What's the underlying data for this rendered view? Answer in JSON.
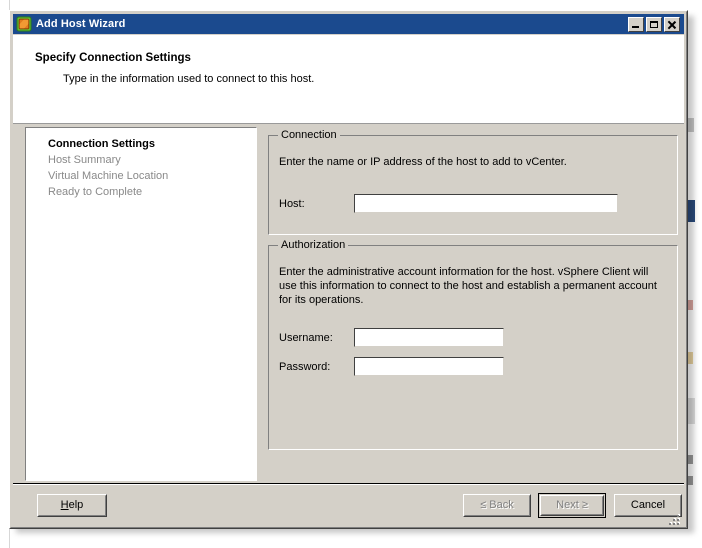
{
  "window": {
    "title": "Add Host Wizard",
    "icon": "vmware-host-icon",
    "controls": {
      "minimize": "minimize-button",
      "maximize": "maximize-button",
      "close": "close-button"
    }
  },
  "header": {
    "title": "Specify Connection Settings",
    "subtitle": "Type in the information used to connect to this host."
  },
  "sidebar": {
    "steps": [
      {
        "label": "Connection Settings",
        "state": "current"
      },
      {
        "label": "Host Summary",
        "state": "pending"
      },
      {
        "label": "Virtual Machine Location",
        "state": "pending"
      },
      {
        "label": "Ready to Complete",
        "state": "pending"
      }
    ]
  },
  "content": {
    "connection": {
      "legend": "Connection",
      "description": "Enter the name or IP address of the host to add to vCenter.",
      "host_label": "Host:",
      "host_value": "",
      "host_placeholder": ""
    },
    "authorization": {
      "legend": "Authorization",
      "description": "Enter the administrative account information for the host. vSphere Client will use this information to connect to the host and establish a permanent account for its operations.",
      "username_label": "Username:",
      "username_value": "",
      "password_label": "Password:",
      "password_value": ""
    }
  },
  "footer": {
    "help": {
      "label": "Help",
      "mnemonic": "H",
      "enabled": true
    },
    "back": {
      "label": "≤ Back",
      "enabled": false
    },
    "next": {
      "label": "Next ≥",
      "enabled": false,
      "is_default": true
    },
    "cancel": {
      "label": "Cancel",
      "enabled": true
    }
  },
  "colors": {
    "titlebar": "#1b4a8e",
    "dialog_face": "#d4d0c8",
    "panel_white": "#ffffff",
    "disabled_text": "#808080",
    "pending_step_text": "#898989"
  }
}
